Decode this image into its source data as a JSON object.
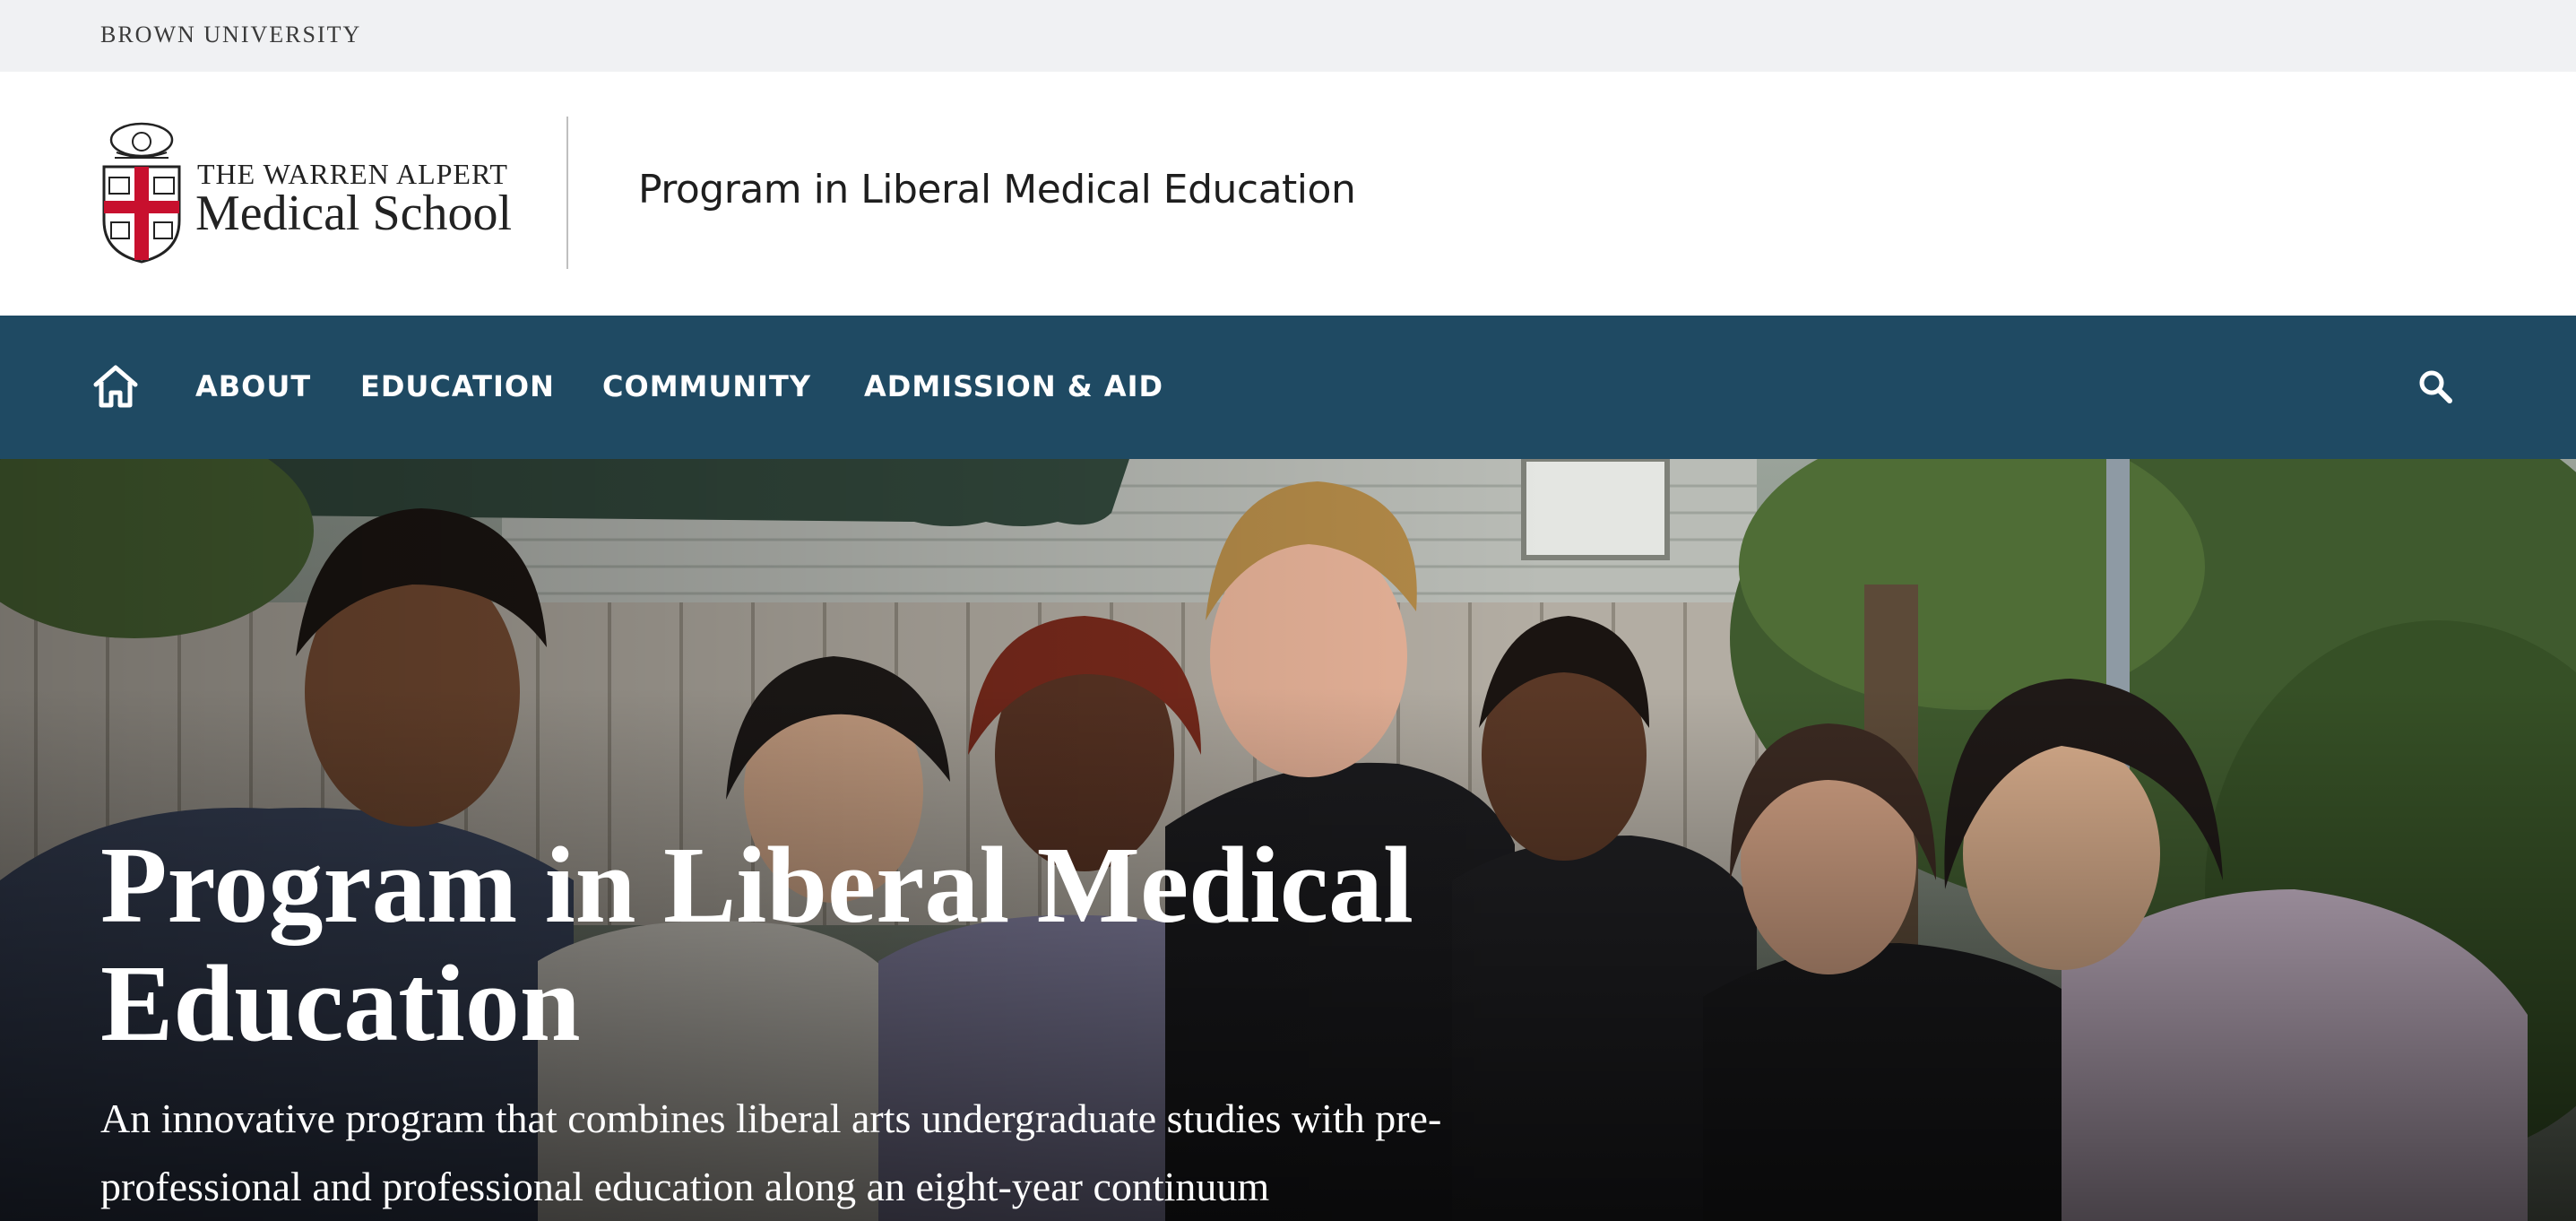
{
  "utility": {
    "university": "BROWN UNIVERSITY"
  },
  "header": {
    "logo_line1": "THE WARREN ALPERT",
    "logo_line2": "Medical School",
    "program_title": "Program in Liberal Medical Education"
  },
  "nav": {
    "home_icon": "home-icon",
    "items": [
      {
        "label": "ABOUT"
      },
      {
        "label": "EDUCATION"
      },
      {
        "label": "COMMUNITY"
      },
      {
        "label": "ADMISSION & AID"
      }
    ],
    "search_icon": "search-icon"
  },
  "hero": {
    "title": "Program in Liberal Medical Education",
    "subtitle": "An innovative program that combines liberal arts undergraduate studies with pre-professional and professional education along an eight-year continuum"
  },
  "colors": {
    "nav_bg": "#1f4a63",
    "utility_bg": "#f0f1f3",
    "brown_red": "#c8102e"
  }
}
